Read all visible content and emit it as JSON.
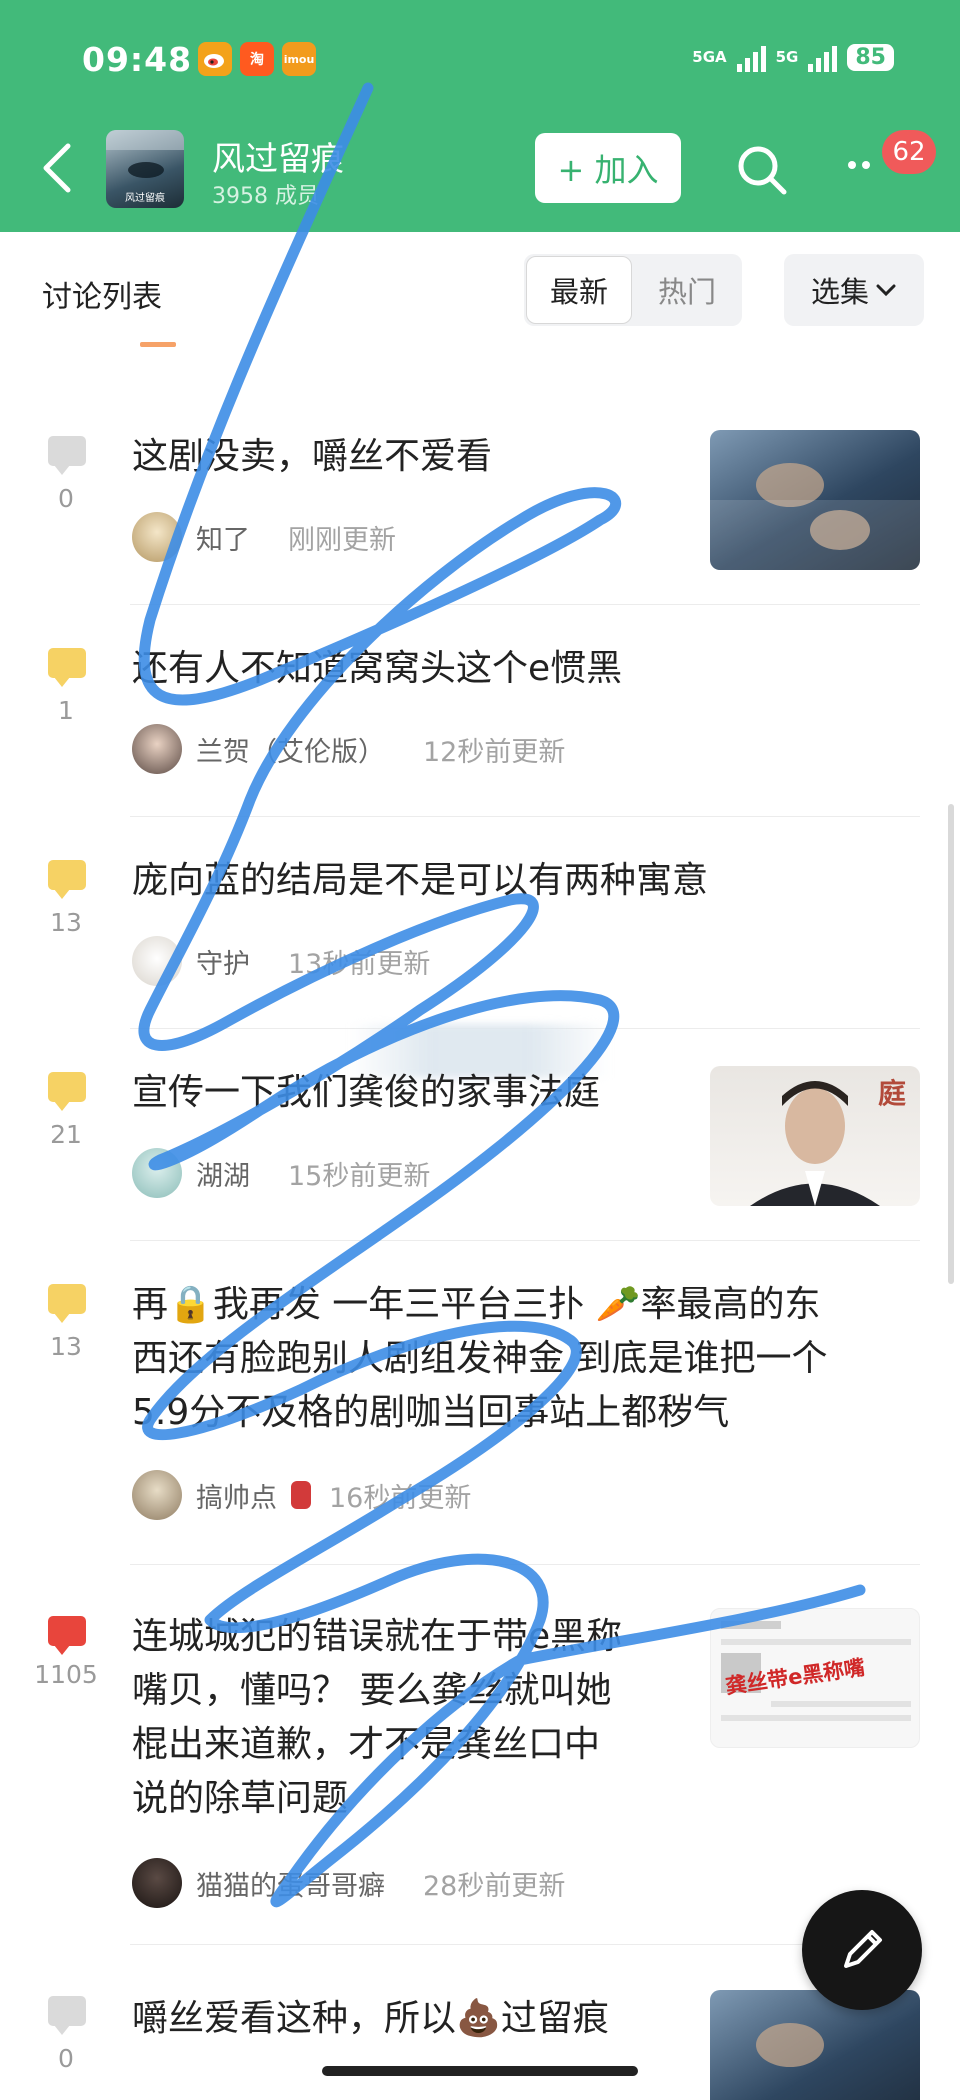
{
  "status_bar": {
    "time": "09:48",
    "network1": "5GA",
    "network2": "5G",
    "battery": "85",
    "apps": [
      {
        "label": "微",
        "color": "#f3a21a"
      },
      {
        "label": "淘",
        "color": "#ff5a1f"
      },
      {
        "label": "imou",
        "color": "#f29b1d"
      }
    ]
  },
  "header": {
    "group_name": "风过留痕",
    "members": "3958 成员",
    "group_avatar_text": "风过留痕",
    "join_label": "+ 加入",
    "badge": "62"
  },
  "tabs": {
    "list_title": "讨论列表",
    "latest": "最新",
    "hot": "热门",
    "collection": "选集"
  },
  "posts": [
    {
      "title_lines": [
        "这剧没卖，嚼丝不爱看"
      ],
      "comments": "0",
      "user": "知了",
      "time": "刚刚更新",
      "icon_color": "#dadada",
      "has_thumb": true
    },
    {
      "title_lines": [
        "还有人不知道窝窝头这个e惯黑"
      ],
      "comments": "1",
      "user": "兰贺（艾伦版）",
      "time": "12秒前更新",
      "icon_color": "#f6d264",
      "has_thumb": false
    },
    {
      "title_lines": [
        "庞向蓝的结局是不是可以有两种寓意"
      ],
      "comments": "13",
      "user": "守护",
      "time": "13秒前更新",
      "icon_color": "#f6d264",
      "has_thumb": false
    },
    {
      "title_lines": [
        "宣传一下我们龚俊的家事法庭"
      ],
      "comments": "21",
      "user": "湖湖",
      "time": "15秒前更新",
      "icon_color": "#f6d264",
      "has_thumb": true,
      "thumb_text": "庭"
    },
    {
      "title_lines": [
        "再🔒我再发 一年三平台三扑 🥕率最高的东",
        "西还有脸跑别人剧组发神金 到底是谁把一个",
        "5.9分不及格的剧咖当回事站上都秽气"
      ],
      "comments": "13",
      "user": "搞帅点",
      "time": "16秒前更新",
      "icon_color": "#f6d264",
      "has_thumb": false
    },
    {
      "title_lines": [
        "连城城犯的错误就在于带e黑称",
        "嘴贝，懂吗？ 要么龚丝就叫她",
        "棍出来道歉，才不是龚丝口中",
        "说的除草问题"
      ],
      "comments": "1105",
      "user": "猫猫的蛋哥哥癖",
      "time": "28秒前更新",
      "icon_color": "#e8453c",
      "has_thumb": true,
      "thumb_text": "龚丝带e黑称嘴"
    },
    {
      "title_lines": [
        "嚼丝爱看这种，所以💩过留痕"
      ],
      "comments": "0",
      "user": "",
      "time": "",
      "icon_color": "#dadada",
      "has_thumb": true
    }
  ]
}
